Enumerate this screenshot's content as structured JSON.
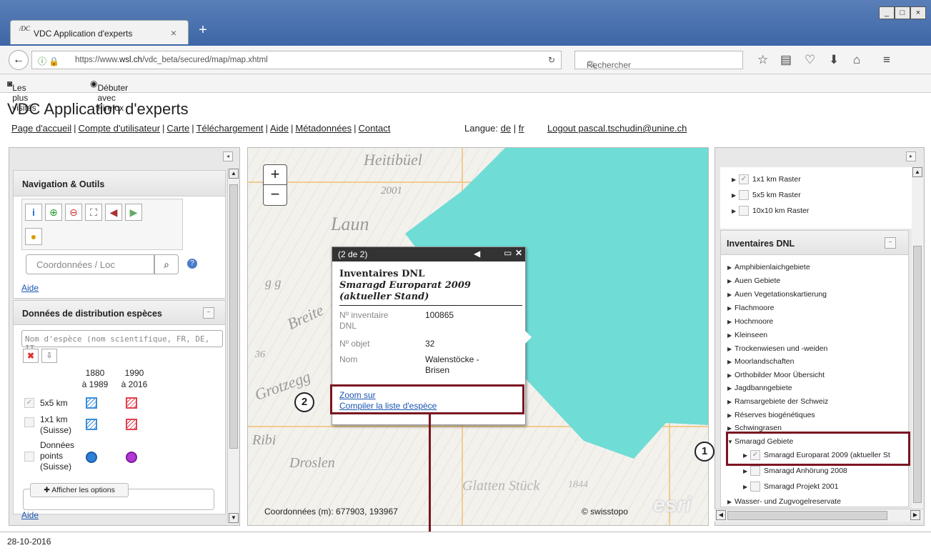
{
  "browser": {
    "tab_logo": "/DC",
    "tab_title": "VDC Application d'experts",
    "url_prefix": "https://www.",
    "url_domain": "wsl.ch",
    "url_path": "/vdc_beta/secured/map/map.xhtml",
    "search_placeholder": "Rechercher",
    "bookmarks": [
      "Les plus visités",
      "Débuter avec Firefox"
    ]
  },
  "app": {
    "title": "VDC Application d'experts",
    "nav": [
      "Page d'accueil",
      "Compte d'utilisateur",
      "Carte",
      "Téléchargement",
      "Aide",
      "Métadonnées",
      "Contact"
    ],
    "lang_label": "Langue:",
    "lang_de": "de",
    "lang_fr": "fr",
    "logout_label": "Logout",
    "user": " pascal.tschudin@unine.ch"
  },
  "left": {
    "nav_title": "Navigation & Outils",
    "coord_placeholder": "Coordonnées / Loc",
    "help_link": "Aide",
    "dist_title": "Données de distribution espèces",
    "species_placeholder": "Nom d'espèce (nom scientifique, FR, DE, IT",
    "col1": [
      "1880",
      "à 1989"
    ],
    "col2": [
      "1990",
      "à 2016"
    ],
    "rows": [
      {
        "label": "5x5 km"
      },
      {
        "label": "1x1 km",
        "sub": "(Suisse)"
      },
      {
        "label": "Données",
        "sub": "points",
        "sub2": "(Suisse)"
      }
    ],
    "options_button": "Afficher les options",
    "help_link2": "Aide"
  },
  "map": {
    "labels": [
      "Heitibüel",
      "2001",
      "Laun",
      "Breite",
      "Grotzegg",
      "Ribi",
      "Droslen",
      "Glatten Stück",
      "1844",
      "36",
      "g g"
    ],
    "coords_text": "Coordonnées (m): 677903, 193967",
    "attribution": "© swisstopo",
    "esri": "esri",
    "zoom_in": "+",
    "zoom_out": "−",
    "water_color": "#6fdcd6"
  },
  "popup": {
    "counter": "(2 de 2)",
    "title1": "Inventaires DNL",
    "title2": "Smaragd Europarat 2009",
    "title3": "(aktueller Stand)",
    "fields": [
      {
        "key": "Nº inventaire",
        "key2": "DNL",
        "value": "100865"
      },
      {
        "key": "Nº objet",
        "value": "32"
      },
      {
        "key": "Nom",
        "value": "Walenstöcke -",
        "value2": "Brisen"
      }
    ],
    "link_zoom": "Zoom sur",
    "link_compile": "Compiler la liste d'espèce"
  },
  "annotations": {
    "one": "1",
    "two": "2",
    "color": "#7a1520"
  },
  "right": {
    "raster": [
      {
        "label": "1x1 km Raster",
        "checked": "✓"
      },
      {
        "label": "5x5 km Raster",
        "checked": ""
      },
      {
        "label": "10x10 km Raster",
        "checked": ""
      }
    ],
    "dnl_title": "Inventaires DNL",
    "dnl_items": [
      "Amphibienlaichgebiete",
      "Auen Gebiete",
      "Auen Vegetationskartierung",
      "Flachmoore",
      "Hochmoore",
      "Kleinseen",
      "Trockenwiesen und -weiden",
      "Moorlandschaften",
      "Orthobilder Moor Übersicht",
      "Jagdbanngebiete",
      "Ramsargebiete der Schweiz",
      "Réserves biogénétiques",
      "Schwingrasen"
    ],
    "smaragd_title": "Smaragd Gebiete",
    "smaragd_items": [
      {
        "label": "Smaragd Europarat 2009 (aktueller St",
        "checked": "✓"
      },
      {
        "label": "Smaragd Anhörung 2008",
        "checked": ""
      },
      {
        "label": "Smaragd Projekt 2001",
        "checked": ""
      }
    ],
    "last_item": "Wasser- und Zugvogelreservate"
  },
  "footer": {
    "date": "28-10-2016"
  }
}
